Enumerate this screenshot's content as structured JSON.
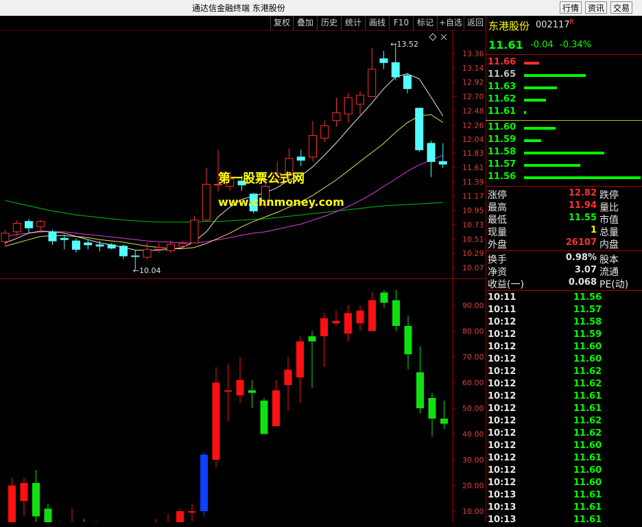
{
  "window": {
    "title": "通达信金融终端  东港股份",
    "buttons": [
      "行情",
      "资讯",
      "交易"
    ]
  },
  "toolbar": {
    "items": [
      "复权",
      "叠加",
      "历史",
      "统计",
      "画线",
      "F10",
      "标记",
      "+自选",
      "返回"
    ],
    "diamond_icon": "diamond-icon"
  },
  "watermark": {
    "line1": "第一股票公式网",
    "line2": "www.chnmoney.com"
  },
  "price_chart": {
    "y_ticks": [
      "13.36",
      "13.14",
      "12.92",
      "12.70",
      "12.48",
      "12.26",
      "12.04",
      "11.83",
      "11.61",
      "11.39",
      "11.17",
      "10.95",
      "10.73",
      "10.51",
      "10.29",
      "10.07"
    ],
    "high_label": "13.52",
    "low_label": "10.04",
    "candles": [
      {
        "o": 10.47,
        "c": 10.6,
        "h": 10.65,
        "l": 10.4
      },
      {
        "o": 10.62,
        "c": 10.75,
        "h": 10.8,
        "l": 10.55
      },
      {
        "o": 10.78,
        "c": 10.68,
        "h": 10.82,
        "l": 10.6
      },
      {
        "o": 10.7,
        "c": 10.78,
        "h": 10.8,
        "l": 10.6
      },
      {
        "o": 10.62,
        "c": 10.48,
        "h": 10.65,
        "l": 10.42
      },
      {
        "o": 10.52,
        "c": 10.5,
        "h": 10.58,
        "l": 10.35
      },
      {
        "o": 10.48,
        "c": 10.35,
        "h": 10.52,
        "l": 10.3
      },
      {
        "o": 10.45,
        "c": 10.42,
        "h": 10.5,
        "l": 10.35
      },
      {
        "o": 10.42,
        "c": 10.4,
        "h": 10.48,
        "l": 10.32
      },
      {
        "o": 10.42,
        "c": 10.37,
        "h": 10.45,
        "l": 10.35
      },
      {
        "o": 10.4,
        "c": 10.25,
        "h": 10.42,
        "l": 10.2
      },
      {
        "o": 10.25,
        "c": 10.24,
        "h": 10.34,
        "l": 10.04
      },
      {
        "o": 10.23,
        "c": 10.35,
        "h": 10.45,
        "l": 10.2
      },
      {
        "o": 10.35,
        "c": 10.38,
        "h": 10.45,
        "l": 10.3
      },
      {
        "o": 10.33,
        "c": 10.43,
        "h": 10.48,
        "l": 10.3
      },
      {
        "o": 10.4,
        "c": 10.44,
        "h": 10.48,
        "l": 10.36
      },
      {
        "o": 10.45,
        "c": 10.8,
        "h": 10.86,
        "l": 10.44
      },
      {
        "o": 10.8,
        "c": 11.35,
        "h": 11.6,
        "l": 10.78
      },
      {
        "o": 11.34,
        "c": 11.35,
        "h": 11.88,
        "l": 11.24
      },
      {
        "o": 11.32,
        "c": 11.43,
        "h": 11.5,
        "l": 11.25
      },
      {
        "o": 11.4,
        "c": 11.34,
        "h": 11.48,
        "l": 11.25
      },
      {
        "o": 11.2,
        "c": 10.94,
        "h": 11.22,
        "l": 10.9
      },
      {
        "o": 11.04,
        "c": 11.32,
        "h": 11.4,
        "l": 10.98
      },
      {
        "o": 11.42,
        "c": 11.52,
        "h": 11.7,
        "l": 11.38
      },
      {
        "o": 11.5,
        "c": 11.75,
        "h": 11.9,
        "l": 11.45
      },
      {
        "o": 11.77,
        "c": 11.72,
        "h": 11.88,
        "l": 11.63
      },
      {
        "o": 11.77,
        "c": 12.1,
        "h": 12.32,
        "l": 11.7
      },
      {
        "o": 12.06,
        "c": 12.25,
        "h": 12.33,
        "l": 12.0
      },
      {
        "o": 12.33,
        "c": 12.45,
        "h": 12.68,
        "l": 12.24
      },
      {
        "o": 12.43,
        "c": 12.68,
        "h": 12.75,
        "l": 12.3
      },
      {
        "o": 12.58,
        "c": 12.72,
        "h": 12.78,
        "l": 12.4
      },
      {
        "o": 12.7,
        "c": 13.12,
        "h": 13.45,
        "l": 12.7
      },
      {
        "o": 13.28,
        "c": 13.22,
        "h": 13.4,
        "l": 13.12
      },
      {
        "o": 13.22,
        "c": 13.0,
        "h": 13.52,
        "l": 12.95
      },
      {
        "o": 13.02,
        "c": 12.82,
        "h": 13.06,
        "l": 12.75
      },
      {
        "o": 12.52,
        "c": 11.88,
        "h": 12.52,
        "l": 11.85
      },
      {
        "o": 11.98,
        "c": 11.7,
        "h": 12.02,
        "l": 11.46
      },
      {
        "o": 11.7,
        "c": 11.66,
        "h": 11.98,
        "l": 11.6
      }
    ],
    "ma5": [
      10.45,
      10.52,
      10.6,
      10.63,
      10.62,
      10.6,
      10.55,
      10.5,
      10.45,
      10.42,
      10.38,
      10.34,
      10.33,
      10.34,
      10.35,
      10.38,
      10.47,
      10.62,
      10.85,
      11.0,
      11.12,
      11.17,
      11.22,
      11.3,
      11.42,
      11.48,
      11.62,
      11.8,
      11.99,
      12.2,
      12.4,
      12.6,
      12.82,
      13.0,
      13.05,
      12.97,
      12.69,
      12.4
    ],
    "ma10": [
      10.4,
      10.45,
      10.5,
      10.55,
      10.56,
      10.56,
      10.55,
      10.53,
      10.5,
      10.48,
      10.46,
      10.43,
      10.4,
      10.38,
      10.36,
      10.36,
      10.38,
      10.44,
      10.52,
      10.6,
      10.7,
      10.78,
      10.85,
      10.92,
      11.0,
      11.08,
      11.18,
      11.3,
      11.42,
      11.56,
      11.7,
      11.84,
      11.98,
      12.15,
      12.3,
      12.4,
      12.42,
      12.3
    ],
    "ma20": [
      10.55,
      10.58,
      10.6,
      10.62,
      10.62,
      10.62,
      10.6,
      10.58,
      10.56,
      10.54,
      10.52,
      10.5,
      10.48,
      10.47,
      10.46,
      10.45,
      10.45,
      10.47,
      10.5,
      10.53,
      10.57,
      10.6,
      10.62,
      10.66,
      10.7,
      10.74,
      10.8,
      10.86,
      10.93,
      11.01,
      11.1,
      11.2,
      11.32,
      11.43,
      11.55,
      11.65,
      11.72,
      11.8
    ],
    "ma60": [
      11.1,
      11.06,
      11.02,
      10.98,
      10.94,
      10.91,
      10.88,
      10.86,
      10.84,
      10.82,
      10.8,
      10.79,
      10.78,
      10.77,
      10.77,
      10.77,
      10.77,
      10.78,
      10.78,
      10.79,
      10.8,
      10.81,
      10.82,
      10.84,
      10.86,
      10.88,
      10.9,
      10.92,
      10.94,
      10.96,
      10.98,
      11.0,
      11.02,
      11.03,
      11.04,
      11.05,
      11.06,
      11.07
    ]
  },
  "indicator_chart": {
    "y_ticks": [
      "90.00",
      "80.00",
      "70.00",
      "60.00",
      "50.00",
      "40.00",
      "30.00",
      "20.00",
      "10.00"
    ],
    "bars": [
      {
        "o": 3,
        "c": 20,
        "h": 23,
        "l": 0
      },
      {
        "o": 14,
        "c": 21,
        "h": 23,
        "l": 8
      },
      {
        "o": 21,
        "c": 8,
        "h": 26,
        "l": 5
      },
      {
        "o": 11,
        "c": 4,
        "h": 13,
        "l": 2
      },
      {
        "o": 5,
        "c": 2,
        "h": 6,
        "l": 1
      },
      {
        "o": 2,
        "c": 4,
        "h": 11,
        "l": 0
      },
      {
        "o": 5,
        "c": 2,
        "h": 7,
        "l": 0
      },
      {
        "o": 4,
        "c": 3,
        "h": 6,
        "l": 1
      },
      {
        "o": 3,
        "c": 2,
        "h": 4,
        "l": 0
      },
      {
        "o": 1,
        "c": 3,
        "h": 6,
        "l": 0
      },
      {
        "o": 4,
        "c": 1,
        "h": 5,
        "l": 0
      },
      {
        "o": 2,
        "c": 2,
        "h": 5,
        "l": 0
      },
      {
        "o": 2,
        "c": 3,
        "h": 7,
        "l": 0
      },
      {
        "o": 1,
        "c": 4,
        "h": 9,
        "l": 0
      },
      {
        "o": 2,
        "c": 10,
        "h": 11,
        "l": 1
      },
      {
        "o": 10,
        "c": 10,
        "h": 13,
        "l": 6
      },
      {
        "o": 10,
        "c": 32,
        "h": 33,
        "l": 8,
        "color": "blue"
      },
      {
        "o": 30,
        "c": 60,
        "h": 66,
        "l": 27
      },
      {
        "o": 57,
        "c": 57,
        "h": 67,
        "l": 45
      },
      {
        "o": 55,
        "c": 61,
        "h": 70,
        "l": 52
      },
      {
        "o": 57,
        "c": 56,
        "h": 61,
        "l": 50
      },
      {
        "o": 53,
        "c": 40,
        "h": 54,
        "l": 40
      },
      {
        "o": 43,
        "c": 57,
        "h": 61,
        "l": 43
      },
      {
        "o": 59,
        "c": 65,
        "h": 70,
        "l": 49
      },
      {
        "o": 62,
        "c": 76,
        "h": 78,
        "l": 52
      },
      {
        "o": 78,
        "c": 76,
        "h": 80,
        "l": 58
      },
      {
        "o": 78,
        "c": 85,
        "h": 87,
        "l": 66
      },
      {
        "o": 83,
        "c": 84,
        "h": 88,
        "l": 82
      },
      {
        "o": 79,
        "c": 87,
        "h": 90,
        "l": 76
      },
      {
        "o": 83,
        "c": 88,
        "h": 90,
        "l": 80
      },
      {
        "o": 80,
        "c": 92,
        "h": 95,
        "l": 80
      },
      {
        "o": 95,
        "c": 91,
        "h": 96,
        "l": 89
      },
      {
        "o": 92,
        "c": 82,
        "h": 96,
        "l": 80
      },
      {
        "o": 82,
        "c": 71,
        "h": 86,
        "l": 65
      },
      {
        "o": 64,
        "c": 50,
        "h": 74,
        "l": 48
      },
      {
        "o": 54,
        "c": 46,
        "h": 56,
        "l": 39
      },
      {
        "o": 46,
        "c": 44,
        "h": 53,
        "l": 42
      }
    ]
  },
  "quote": {
    "name": "东港股份",
    "code": "002117",
    "r_mark": "R",
    "price": "11.61",
    "change": "-0.04",
    "change_pct": "-0.34%",
    "asks": [
      {
        "price": "11.66",
        "vol": 22,
        "color": "#ff3030"
      },
      {
        "price": "11.65",
        "vol": 90,
        "color": "#c0c0c0"
      },
      {
        "price": "11.63",
        "vol": 48,
        "color": "#00ff00"
      },
      {
        "price": "11.62",
        "vol": 32,
        "color": "#00ff00"
      },
      {
        "price": "11.61",
        "vol": 3,
        "color": "#00ff00"
      }
    ],
    "bids": [
      {
        "price": "11.60",
        "vol": 46,
        "color": "#00ff00"
      },
      {
        "price": "11.59",
        "vol": 25,
        "color": "#00ff00"
      },
      {
        "price": "11.58",
        "vol": 117,
        "color": "#00ff00"
      },
      {
        "price": "11.57",
        "vol": 82,
        "color": "#00ff00"
      },
      {
        "price": "11.56",
        "vol": 170,
        "color": "#00ff00"
      }
    ],
    "stats": [
      {
        "l": "涨停",
        "v": "12.82",
        "c": "#ff3030",
        "r": "跌停"
      },
      {
        "l": "最高",
        "v": "11.94",
        "c": "#ff3030",
        "r": "量比"
      },
      {
        "l": "最低",
        "v": "11.55",
        "c": "#00ff00",
        "r": "市值"
      },
      {
        "l": "现量",
        "v": "1",
        "c": "#ffff00",
        "r": "总量"
      },
      {
        "l": "外盘",
        "v": "26107",
        "c": "#ff3030",
        "r": "内盘"
      }
    ],
    "stats2": [
      {
        "l": "换手",
        "v": "0.98%",
        "c": "#e0e0e0",
        "r": "股本"
      },
      {
        "l": "净资",
        "v": "3.07",
        "c": "#e0e0e0",
        "r": "流通"
      },
      {
        "l": "收益(一)",
        "v": "0.068",
        "c": "#e0e0e0",
        "r": "PE(动)"
      }
    ],
    "ticks": [
      {
        "t": "10:11",
        "p": "11.56"
      },
      {
        "t": "10:11",
        "p": "11.57"
      },
      {
        "t": "10:12",
        "p": "11.58"
      },
      {
        "t": "10:12",
        "p": "11.59"
      },
      {
        "t": "10:12",
        "p": "11.60"
      },
      {
        "t": "10:12",
        "p": "11.60"
      },
      {
        "t": "10:12",
        "p": "11.62"
      },
      {
        "t": "10:12",
        "p": "11.62"
      },
      {
        "t": "10:12",
        "p": "11.61"
      },
      {
        "t": "10:12",
        "p": "11.61"
      },
      {
        "t": "10:12",
        "p": "11.62"
      },
      {
        "t": "10:12",
        "p": "11.62"
      },
      {
        "t": "10:12",
        "p": "11.60"
      },
      {
        "t": "10:12",
        "p": "11.61"
      },
      {
        "t": "10:12",
        "p": "11.60"
      },
      {
        "t": "10:12",
        "p": "11.60"
      },
      {
        "t": "10:13",
        "p": "11.61"
      },
      {
        "t": "10:13",
        "p": "11.61"
      },
      {
        "t": "10:13",
        "p": "11.61"
      }
    ]
  }
}
